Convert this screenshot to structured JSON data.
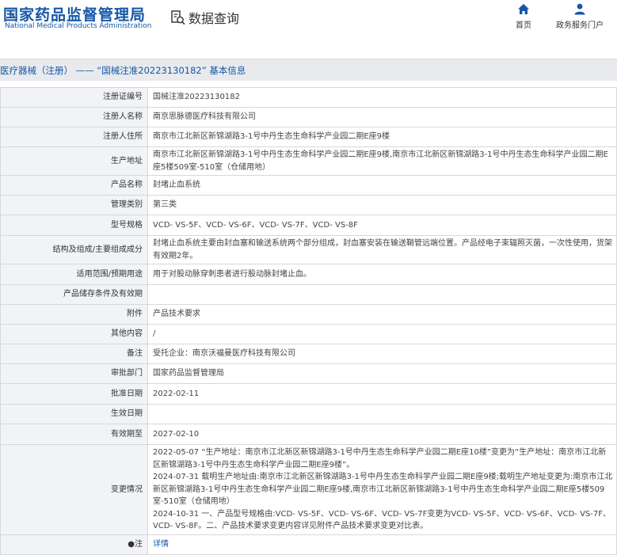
{
  "header": {
    "logo_cn": "国家药品监督管理局",
    "logo_en": "National Medical Products Administration",
    "query_title": "数据查询",
    "query_icon": "search-doc-icon",
    "nav": [
      {
        "label": "首页",
        "icon": "home-icon"
      },
      {
        "label": "政务服务门户",
        "icon": "user-icon"
      }
    ]
  },
  "breadcrumb": "医疗器械（注册） —— “国械注准20223130182” 基本信息",
  "rows": [
    {
      "label": "注册证编号",
      "value": "国械注准20223130182"
    },
    {
      "label": "注册人名称",
      "value": "南京思脉德医疗科技有限公司"
    },
    {
      "label": "注册人住所",
      "value": "南京市江北新区新锦湖路3-1号中丹生态生命科学产业园二期E座9楼"
    },
    {
      "label": "生产地址",
      "value": "南京市江北新区新锦湖路3-1号中丹生态生命科学产业园二期E座9楼,南京市江北新区新锦湖路3-1号中丹生态生命科学产业园二期E座5楼509室-510室（仓储用地）"
    },
    {
      "label": "产品名称",
      "value": "封堵止血系统"
    },
    {
      "label": "管理类别",
      "value": "第三类"
    },
    {
      "label": "型号规格",
      "value": "VCD- VS-5F、VCD- VS-6F、VCD- VS-7F、VCD- VS-8F"
    },
    {
      "label": "结构及组成/主要组成成分",
      "value": "封堵止血系统主要由封血塞和输送系统两个部分组成，封血塞安装在输送鞘管远端位置。产品经电子束辐照灭菌，一次性使用，货架有效期2年。"
    },
    {
      "label": "适用范围/预期用途",
      "value": "用于对股动脉穿刺患者进行股动脉封堵止血。"
    },
    {
      "label": "产品储存条件及有效期",
      "value": ""
    },
    {
      "label": "附件",
      "value": "产品技术要求"
    },
    {
      "label": "其他内容",
      "value": "/"
    },
    {
      "label": "备注",
      "value": "受托企业：南京沃福曼医疗科技有限公司"
    },
    {
      "label": "审批部门",
      "value": "国家药品监督管理局"
    },
    {
      "label": "批准日期",
      "value": "2022-02-11"
    },
    {
      "label": "生效日期",
      "value": ""
    },
    {
      "label": "有效期至",
      "value": "2027-02-10"
    },
    {
      "label": "变更情况",
      "value_lines": [
        "2022-05-07 “生产地址：南京市江北新区新锦湖路3-1号中丹生态生命科学产业园二期E座10楼”变更为“生产地址：南京市江北新区新锦湖路3-1号中丹生态生命科学产业园二期E座9楼”。",
        "2024-07-31 载明生产地址由:南京市江北新区新锦湖路3-1号中丹生态生命科学产业园二期E座9楼;载明生产地址变更为:南京市江北新区新锦湖路3-1号中丹生态生命科学产业园二期E座9楼,南京市江北新区新锦湖路3-1号中丹生态生命科学产业园二期E座5楼509室-510室（仓储用地）",
        "2024-10-31 一、产品型号规格由:VCD- VS-5F、VCD- VS-6F、VCD- VS-7F变更为VCD- VS-5F、VCD- VS-6F、VCD- VS-7F、VCD- VS-8F。二、产品技术要求变更内容详见附件产品技术要求变更对比表。"
      ]
    },
    {
      "label": "●注",
      "value": "详情",
      "link": true
    }
  ]
}
